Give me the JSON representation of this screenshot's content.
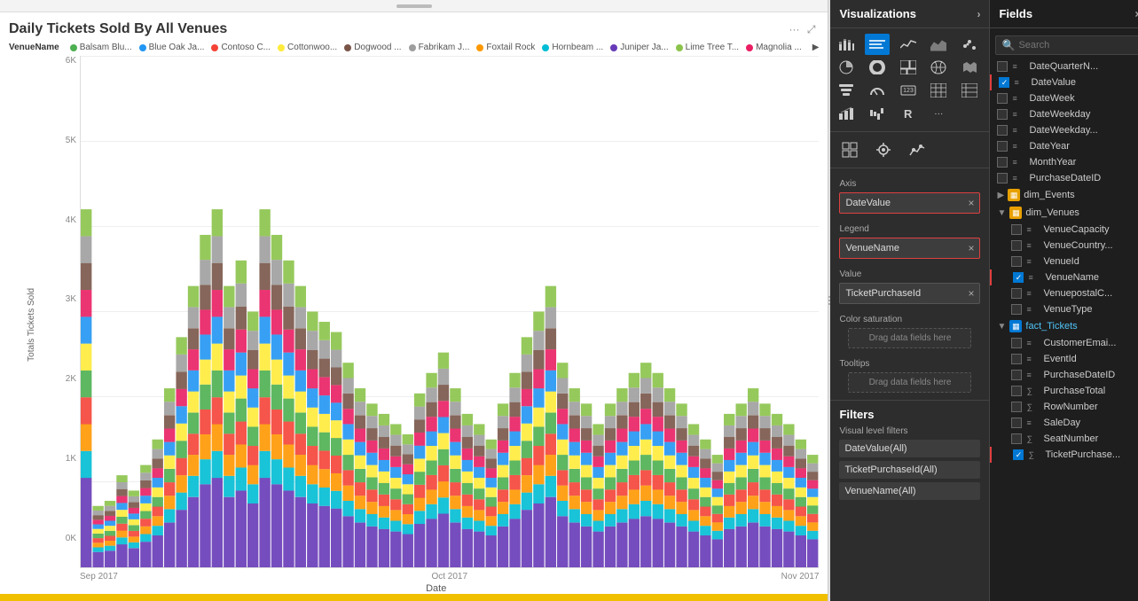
{
  "chart": {
    "title": "Daily Tickets Sold By All Venues",
    "x_axis_label": "Date",
    "y_axis_label": "Totals Tickets Sold",
    "y_ticks": [
      "6K",
      "5K",
      "4K",
      "3K",
      "2K",
      "1K",
      "0K"
    ],
    "x_ticks": [
      "Sep 2017",
      "Oct 2017",
      "Nov 2017"
    ],
    "venue_label": "VenueName",
    "legend_items": [
      {
        "name": "Balsam Blu...",
        "color": "#4CAF50"
      },
      {
        "name": "Blue Oak Ja...",
        "color": "#2196F3"
      },
      {
        "name": "Contoso C...",
        "color": "#F44336"
      },
      {
        "name": "Cottonwoo...",
        "color": "#FFEB3B"
      },
      {
        "name": "Dogwood ...",
        "color": "#795548"
      },
      {
        "name": "Fabrikam J...",
        "color": "#9E9E9E"
      },
      {
        "name": "Foxtail Rock",
        "color": "#FF9800"
      },
      {
        "name": "Hornbeam ...",
        "color": "#00BCD4"
      },
      {
        "name": "Juniper Ja...",
        "color": "#673AB7"
      },
      {
        "name": "Lime Tree T...",
        "color": "#8BC34A"
      },
      {
        "name": "Magnolia ...",
        "color": "#E91E63"
      }
    ]
  },
  "visualizations": {
    "panel_title": "Visualizations",
    "panel_arrow": "›"
  },
  "viz_icons": [
    {
      "name": "bar-chart-icon",
      "symbol": "▦",
      "active": false
    },
    {
      "name": "stacked-bar-icon",
      "symbol": "▥",
      "active": true
    },
    {
      "name": "line-chart-icon",
      "symbol": "📈",
      "active": false
    },
    {
      "name": "area-chart-icon",
      "symbol": "▲",
      "active": false
    },
    {
      "name": "scatter-icon",
      "symbol": "⋯",
      "active": false
    },
    {
      "name": "pie-icon",
      "symbol": "◑",
      "active": false
    },
    {
      "name": "donut-icon",
      "symbol": "◎",
      "active": false
    },
    {
      "name": "treemap-icon",
      "symbol": "▪",
      "active": false
    },
    {
      "name": "funnel-icon",
      "symbol": "⏚",
      "active": false
    },
    {
      "name": "gauge-icon",
      "symbol": "◐",
      "active": false
    },
    {
      "name": "card-icon",
      "symbol": "▭",
      "active": false
    },
    {
      "name": "table-icon",
      "symbol": "⊞",
      "active": false
    },
    {
      "name": "matrix-icon",
      "symbol": "⊟",
      "active": false
    },
    {
      "name": "map-icon",
      "symbol": "🗺",
      "active": false
    },
    {
      "name": "r-icon",
      "symbol": "R",
      "active": false
    },
    {
      "name": "more-icon",
      "symbol": "···",
      "active": false
    }
  ],
  "field_wells": {
    "axis_label": "Axis",
    "axis_value": "DateValue",
    "legend_label": "Legend",
    "legend_value": "VenueName",
    "value_label": "Value",
    "value_value": "TicketPurchaseId",
    "color_saturation_label": "Color saturation",
    "color_saturation_placeholder": "Drag data fields here",
    "tooltips_label": "Tooltips",
    "tooltips_placeholder": "Drag data fields here"
  },
  "filters": {
    "label": "Filters",
    "visual_level_label": "Visual level filters",
    "items": [
      "DateValue(All)",
      "TicketPurchaseId(All)",
      "VenueName(All)"
    ]
  },
  "fields": {
    "panel_title": "Fields",
    "panel_arrow": "×",
    "search_placeholder": "Search",
    "items": [
      {
        "type": "dimension",
        "name": "DateQuarterN...",
        "checked": false,
        "highlighted": false
      },
      {
        "type": "dimension",
        "name": "DateValue",
        "checked": true,
        "highlighted": true
      },
      {
        "type": "dimension",
        "name": "DateWeek",
        "checked": false,
        "highlighted": false
      },
      {
        "type": "dimension",
        "name": "DateWeekday",
        "checked": false,
        "highlighted": false
      },
      {
        "type": "dimension",
        "name": "DateWeekday...",
        "checked": false,
        "highlighted": false
      },
      {
        "type": "dimension",
        "name": "DateYear",
        "checked": false,
        "highlighted": false
      },
      {
        "type": "dimension",
        "name": "MonthYear",
        "checked": false,
        "highlighted": false
      },
      {
        "type": "dimension",
        "name": "PurchaseDateID",
        "checked": false,
        "highlighted": false
      }
    ],
    "groups": [
      {
        "name": "dim_Events",
        "collapsed": true,
        "color": "#e8a000"
      },
      {
        "name": "dim_Venues",
        "collapsed": false,
        "color": "#e8a000",
        "items": [
          {
            "type": "dimension",
            "name": "VenueCapacity",
            "checked": false,
            "highlighted": false
          },
          {
            "type": "dimension",
            "name": "VenueCountry...",
            "checked": false,
            "highlighted": false
          },
          {
            "type": "dimension",
            "name": "VenueId",
            "checked": false,
            "highlighted": false
          },
          {
            "type": "dimension",
            "name": "VenueName",
            "checked": true,
            "highlighted": true
          },
          {
            "type": "dimension",
            "name": "VenuepostalC...",
            "checked": false,
            "highlighted": false
          },
          {
            "type": "dimension",
            "name": "VenueType",
            "checked": false,
            "highlighted": false
          }
        ]
      },
      {
        "name": "fact_Tickets",
        "collapsed": false,
        "color": "#0078d4",
        "items": [
          {
            "type": "dimension",
            "name": "CustomerEmai...",
            "checked": false,
            "highlighted": false
          },
          {
            "type": "dimension",
            "name": "EventId",
            "checked": false,
            "highlighted": false
          },
          {
            "type": "dimension",
            "name": "PurchaseDateID",
            "checked": false,
            "highlighted": false
          },
          {
            "type": "measure",
            "name": "PurchaseTotal",
            "checked": false,
            "highlighted": false
          },
          {
            "type": "measure",
            "name": "RowNumber",
            "checked": false,
            "highlighted": false
          },
          {
            "type": "dimension",
            "name": "SaleDay",
            "checked": false,
            "highlighted": false
          },
          {
            "type": "measure",
            "name": "SeatNumber",
            "checked": false,
            "highlighted": false
          },
          {
            "type": "measure",
            "name": "TicketPurchase...",
            "checked": true,
            "highlighted": true
          }
        ]
      }
    ]
  }
}
